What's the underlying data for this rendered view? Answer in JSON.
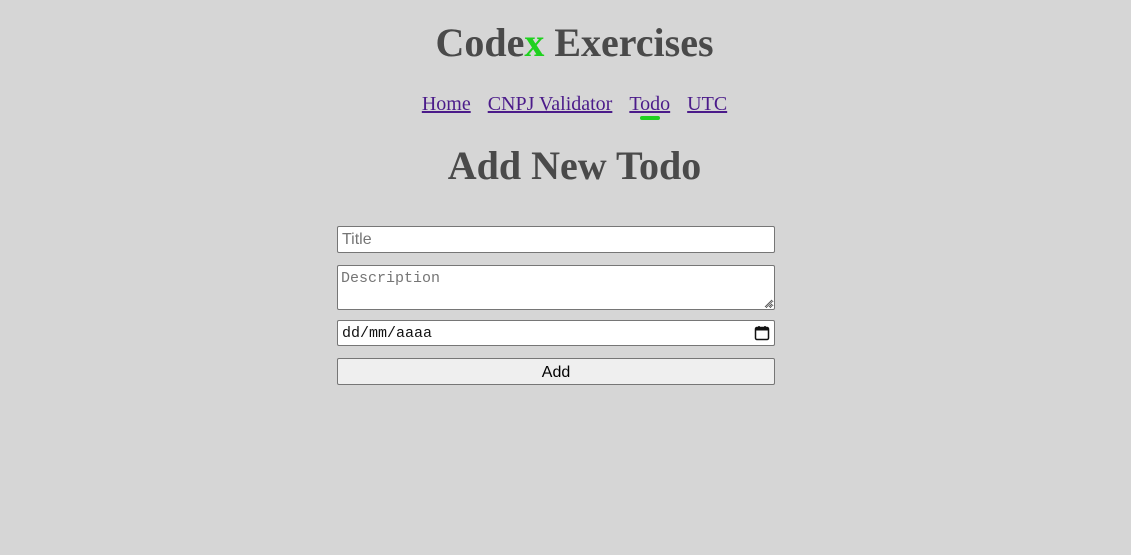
{
  "header": {
    "brand_prefix": "Code",
    "brand_accent": "x",
    "brand_suffix": " Exercises",
    "accent_color": "#1fd11f"
  },
  "nav": {
    "items": [
      {
        "label": "Home",
        "active": false
      },
      {
        "label": "CNPJ Validator",
        "active": false
      },
      {
        "label": "Todo",
        "active": true
      },
      {
        "label": "UTC",
        "active": false
      }
    ]
  },
  "page": {
    "title": "Add New Todo"
  },
  "form": {
    "title_placeholder": "Title",
    "title_value": "",
    "description_placeholder": "Description",
    "description_value": "",
    "date_display": "dd/mm/aaaa",
    "date_icon": "calendar-icon",
    "add_label": "Add"
  },
  "colors": {
    "background": "#d6d6d6",
    "heading": "#4a4a4a",
    "link": "#4b1b8a"
  }
}
